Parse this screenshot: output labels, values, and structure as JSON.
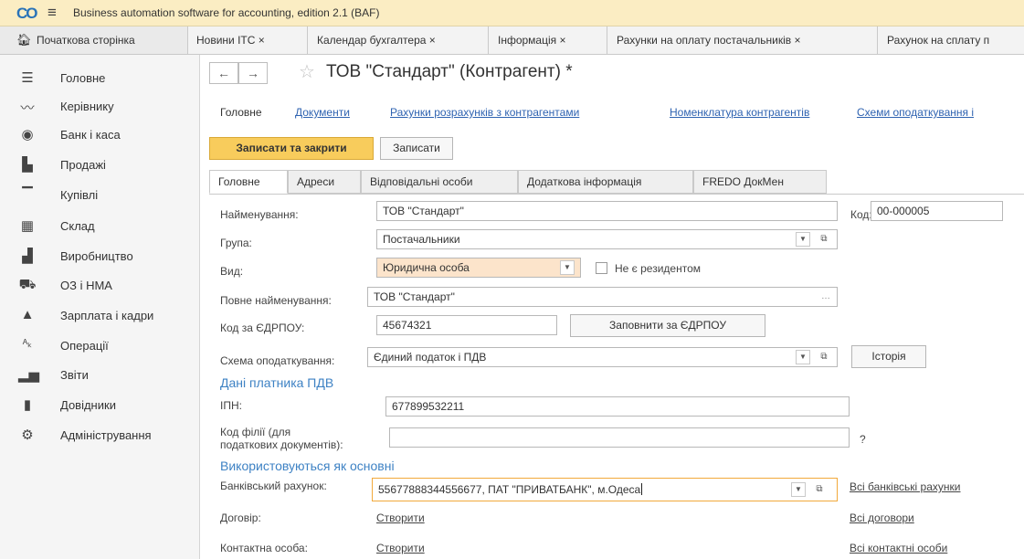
{
  "app": {
    "title": "Business automation software for accounting, edition 2.1  (BAF)",
    "logo_icon": "1c-logo-icon",
    "menu_icon": "hamburger-icon"
  },
  "tabs": {
    "home": "Початкова сторінка",
    "open": [
      "Новини ITC ×",
      "Календар бухгалтера ×",
      "Інформація ×",
      "Рахунки на оплату постачальників ×",
      "Рахунок на сплату п"
    ]
  },
  "sidebar": {
    "items": [
      {
        "label": "Головне",
        "icon": "menu-lines-icon"
      },
      {
        "label": "Керівнику",
        "icon": "trend-icon"
      },
      {
        "label": "Банк і каса",
        "icon": "bank-icon"
      },
      {
        "label": "Продажі",
        "icon": "shop-icon"
      },
      {
        "label": "Купівлі",
        "icon": "cart-icon"
      },
      {
        "label": "Склад",
        "icon": "warehouse-icon"
      },
      {
        "label": "Виробництво",
        "icon": "factory-icon"
      },
      {
        "label": "ОЗ і НМА",
        "icon": "truck-icon"
      },
      {
        "label": "Зарплата і кадри",
        "icon": "person-icon"
      },
      {
        "label": "Операції",
        "icon": "operations-icon"
      },
      {
        "label": "Звіти",
        "icon": "bar-chart-icon"
      },
      {
        "label": "Довідники",
        "icon": "book-icon"
      },
      {
        "label": "Адміністрування",
        "icon": "gear-icon"
      }
    ]
  },
  "form": {
    "back": "←",
    "forward": "→",
    "star": "☆",
    "title": "ТОВ \"Стандарт\" (Контрагент) *",
    "section_tabs": [
      "Головне",
      "Документи",
      "Рахунки розрахунків з контрагентами",
      "Номенклатура контрагентів",
      "Схеми оподаткування і"
    ],
    "save_close": "Записати та закрити",
    "save": "Записати",
    "form_tabs": [
      "Головне",
      "Адреси",
      "Відповідальні особи",
      "Додаткова інформація",
      "FREDO ДокМен"
    ],
    "name_label": "Найменування:",
    "name_value": "ТОВ \"Стандарт\"",
    "code_label": "Код:",
    "code_value": "00-000005",
    "group_label": "Група:",
    "group_value": "Постачальники",
    "kind_label": "Вид:",
    "kind_value": "Юридична особа",
    "nonresident_label": "Не є резидентом",
    "nonresident_checked": false,
    "fullname_label": "Повне найменування:",
    "fullname_value": "ТОВ \"Стандарт\"",
    "edrpou_label": "Код за ЄДРПОУ:",
    "edrpou_value": "45674321",
    "fill_edrpou": "Заповнити за ЄДРПОУ",
    "tax_label": "Схема оподаткування:",
    "tax_value": "Єдиний податок і ПДВ",
    "history": "Історія",
    "vat_section": "Дані платника ПДВ",
    "ipn_label": "ІПН:",
    "ipn_value": "677899532211",
    "branch_label_1": "Код філії (для",
    "branch_label_2": "податкових документів):",
    "branch_value": "",
    "help": "?",
    "used_section": "Використовуються як основні",
    "bank_label": "Банківський рахунок:",
    "bank_value": "55677888344556677, ПАТ \"ПРИВАТБАНК\", м.Одеса",
    "all_banks": "Всі банківські рахунки",
    "contract_label": "Договір:",
    "contract_create": "Створити",
    "all_contracts": "Всі договори",
    "contact_label": "Контактна особа:",
    "contact_create": "Створити",
    "all_contacts": "Всі контактні особи"
  }
}
